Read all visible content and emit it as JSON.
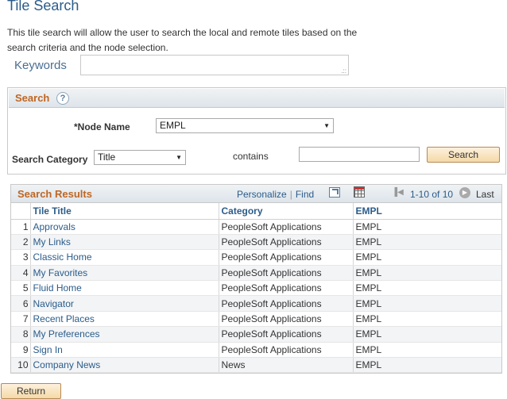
{
  "page": {
    "title": "Tile Search",
    "description": "This tile search will allow the user to search the local and remote tiles based on the search criteria and the node selection."
  },
  "keywords": {
    "label": "Keywords",
    "value": ""
  },
  "search": {
    "title": "Search",
    "help_icon": "?",
    "node_name_label": "*Node Name",
    "node_name_value": "EMPL",
    "category_label": "Search Category",
    "category_value": "Title",
    "operator": "contains",
    "query_value": "",
    "search_button": "Search"
  },
  "results": {
    "title": "Search Results",
    "personalize": "Personalize",
    "find": "Find",
    "range": "1-10 of 10",
    "last": "Last",
    "columns": [
      "Tile Title",
      "Category",
      "EMPL"
    ],
    "rows": [
      {
        "num": "1",
        "title": "Approvals",
        "category": "PeopleSoft Applications",
        "node": "EMPL"
      },
      {
        "num": "2",
        "title": "My Links",
        "category": "PeopleSoft Applications",
        "node": "EMPL"
      },
      {
        "num": "3",
        "title": "Classic Home",
        "category": "PeopleSoft Applications",
        "node": "EMPL"
      },
      {
        "num": "4",
        "title": "My Favorites",
        "category": "PeopleSoft Applications",
        "node": "EMPL"
      },
      {
        "num": "5",
        "title": "Fluid Home",
        "category": "PeopleSoft Applications",
        "node": "EMPL"
      },
      {
        "num": "6",
        "title": "Navigator",
        "category": "PeopleSoft Applications",
        "node": "EMPL"
      },
      {
        "num": "7",
        "title": "Recent Places",
        "category": "PeopleSoft Applications",
        "node": "EMPL"
      },
      {
        "num": "8",
        "title": "My Preferences",
        "category": "PeopleSoft Applications",
        "node": "EMPL"
      },
      {
        "num": "9",
        "title": "Sign In",
        "category": "PeopleSoft Applications",
        "node": "EMPL"
      },
      {
        "num": "10",
        "title": "Company News",
        "category": "News",
        "node": "EMPL"
      }
    ]
  },
  "footer": {
    "return_button": "Return"
  }
}
